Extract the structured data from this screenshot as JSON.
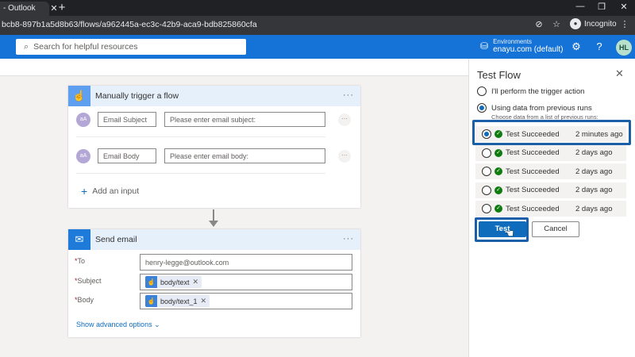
{
  "browser": {
    "tab_title": "- Outlook",
    "tab_close": "✕",
    "new_tab": "+",
    "url": "bcb8-897b1a5d8b63/flows/a962445a-ec3c-42b9-aca9-bdb825860cfa",
    "incognito_label": "Incognito"
  },
  "header": {
    "search_placeholder": "Search for helpful resources",
    "env_label": "Environments",
    "env_value": "enayu.com (default)",
    "avatar_initials": "HL"
  },
  "trigger": {
    "title": "Manually trigger a flow",
    "inputs": [
      {
        "icon_text": "aA",
        "name": "Email Subject",
        "placeholder": "Please enter email subject:"
      },
      {
        "icon_text": "aA",
        "name": "Email Body",
        "placeholder": "Please enter email body:"
      }
    ],
    "add_input_label": "Add an input"
  },
  "send_email": {
    "title": "Send email",
    "fields": [
      {
        "label": "To",
        "value": "henry-legge@outlook.com"
      },
      {
        "label": "Subject",
        "token": "body/text"
      },
      {
        "label": "Body",
        "token": "body/text_1"
      }
    ],
    "show_advanced": "Show advanced options"
  },
  "test_panel": {
    "title": "Test Flow",
    "option_manual": "I'll perform the trigger action",
    "option_previous": "Using data from previous runs",
    "previous_hint": "Choose data from a list of previous runs:",
    "runs": [
      {
        "status": "Test Succeeded",
        "time": "2 minutes ago",
        "selected": true
      },
      {
        "status": "Test Succeeded",
        "time": "2 days ago",
        "selected": false
      },
      {
        "status": "Test Succeeded",
        "time": "2 days ago",
        "selected": false
      },
      {
        "status": "Test Succeeded",
        "time": "2 days ago",
        "selected": false
      },
      {
        "status": "Test Succeeded",
        "time": "2 days ago",
        "selected": false
      }
    ],
    "test_button": "Test",
    "cancel_button": "Cancel"
  },
  "colors": {
    "accent": "#0f6cbd",
    "success": "#107c10",
    "highlight": "#1b5fa8"
  }
}
